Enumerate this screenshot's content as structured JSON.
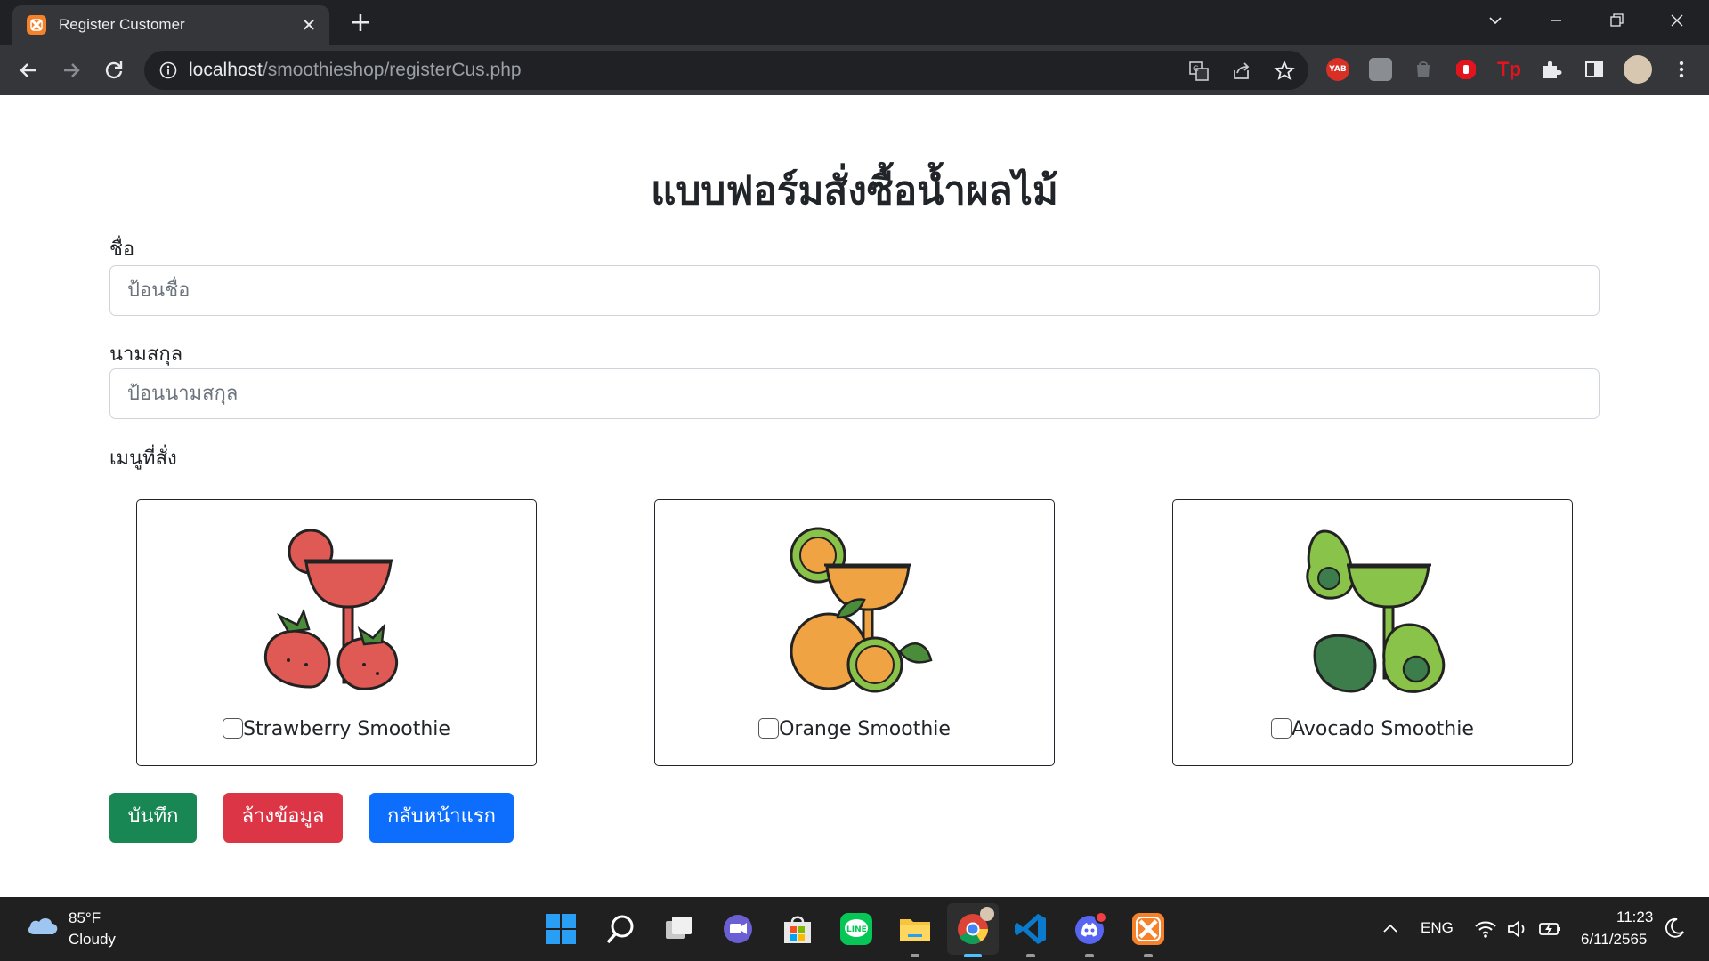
{
  "browser": {
    "tab_title": "Register Customer",
    "url_host": "localhost",
    "url_path": "/smoothieshop/registerCus.php"
  },
  "page": {
    "title": "แบบฟอร์มสั่งซื้อน้ำผลไม้",
    "first_name": {
      "label": "ชื่อ",
      "placeholder": "ป้อนชื่อ",
      "value": ""
    },
    "last_name": {
      "label": "นามสกุล",
      "placeholder": "ป้อนนามสกุล",
      "value": ""
    },
    "menu_label": "เมนูที่สั่ง",
    "menu_items": [
      {
        "label": "Strawberry Smoothie",
        "checked": false,
        "color": "#e05a55"
      },
      {
        "label": "Orange Smoothie",
        "checked": false,
        "color": "#f0a343"
      },
      {
        "label": "Avocado Smoothie",
        "checked": false,
        "color": "#8ac34a"
      }
    ],
    "buttons": {
      "save": "บันทึก",
      "clear": "ล้างข้อมูล",
      "home": "กลับหน้าแรก"
    },
    "colors": {
      "save": "#198754",
      "clear": "#dc3545",
      "home": "#0d6efd"
    }
  },
  "taskbar": {
    "weather_temp": "85°F",
    "weather_cond": "Cloudy",
    "language": "ENG",
    "time": "11:23",
    "date": "6/11/2565",
    "apps": [
      "start-icon",
      "search-icon",
      "task-view-icon",
      "chat-icon",
      "store-icon",
      "line-icon",
      "file-explorer-icon",
      "chrome-icon",
      "vscode-icon",
      "discord-icon",
      "xampp-icon"
    ]
  }
}
